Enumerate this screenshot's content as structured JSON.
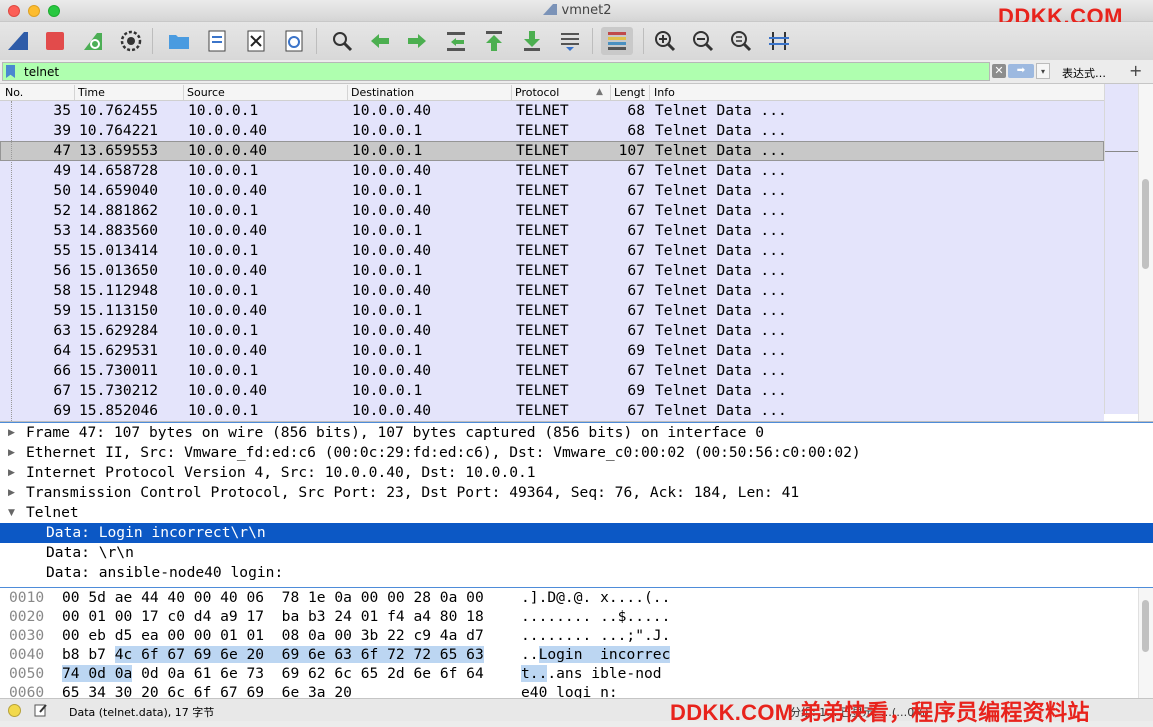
{
  "window": {
    "title": "vmnet2",
    "watermark_top": "DDKK.COM",
    "watermark_bottom": "DDKK.COM 弟弟快看，程序员编程资料站"
  },
  "toolbar": {
    "buttons": [
      "start-capture-icon",
      "stop-capture-icon",
      "restart-capture-icon",
      "capture-options-icon",
      "open-file-icon",
      "save-file-icon",
      "close-file-icon",
      "reload-file-icon",
      "find-packet-icon",
      "go-back-icon",
      "go-forward-icon",
      "go-to-packet-icon",
      "go-first-icon",
      "go-last-icon",
      "autoscroll-icon",
      "colorize-icon",
      "zoom-in-icon",
      "zoom-out-icon",
      "zoom-normal-icon",
      "resize-columns-icon"
    ]
  },
  "filter": {
    "value": "telnet",
    "expression_label": "表达式…",
    "plus_label": "+"
  },
  "columns": [
    "No.",
    "Time",
    "Source",
    "Destination",
    "Protocol",
    "Lengt",
    "Info"
  ],
  "packets": [
    {
      "no": "35",
      "time": "10.762455",
      "src": "10.0.0.1",
      "dst": "10.0.0.40",
      "proto": "TELNET",
      "len": "68",
      "info": "Telnet Data ..."
    },
    {
      "no": "39",
      "time": "10.764221",
      "src": "10.0.0.40",
      "dst": "10.0.0.1",
      "proto": "TELNET",
      "len": "68",
      "info": "Telnet Data ..."
    },
    {
      "no": "47",
      "time": "13.659553",
      "src": "10.0.0.40",
      "dst": "10.0.0.1",
      "proto": "TELNET",
      "len": "107",
      "info": "Telnet Data ...",
      "selected": true
    },
    {
      "no": "49",
      "time": "14.658728",
      "src": "10.0.0.1",
      "dst": "10.0.0.40",
      "proto": "TELNET",
      "len": "67",
      "info": "Telnet Data ..."
    },
    {
      "no": "50",
      "time": "14.659040",
      "src": "10.0.0.40",
      "dst": "10.0.0.1",
      "proto": "TELNET",
      "len": "67",
      "info": "Telnet Data ..."
    },
    {
      "no": "52",
      "time": "14.881862",
      "src": "10.0.0.1",
      "dst": "10.0.0.40",
      "proto": "TELNET",
      "len": "67",
      "info": "Telnet Data ..."
    },
    {
      "no": "53",
      "time": "14.883560",
      "src": "10.0.0.40",
      "dst": "10.0.0.1",
      "proto": "TELNET",
      "len": "67",
      "info": "Telnet Data ..."
    },
    {
      "no": "55",
      "time": "15.013414",
      "src": "10.0.0.1",
      "dst": "10.0.0.40",
      "proto": "TELNET",
      "len": "67",
      "info": "Telnet Data ..."
    },
    {
      "no": "56",
      "time": "15.013650",
      "src": "10.0.0.40",
      "dst": "10.0.0.1",
      "proto": "TELNET",
      "len": "67",
      "info": "Telnet Data ..."
    },
    {
      "no": "58",
      "time": "15.112948",
      "src": "10.0.0.1",
      "dst": "10.0.0.40",
      "proto": "TELNET",
      "len": "67",
      "info": "Telnet Data ..."
    },
    {
      "no": "59",
      "time": "15.113150",
      "src": "10.0.0.40",
      "dst": "10.0.0.1",
      "proto": "TELNET",
      "len": "67",
      "info": "Telnet Data ..."
    },
    {
      "no": "63",
      "time": "15.629284",
      "src": "10.0.0.1",
      "dst": "10.0.0.40",
      "proto": "TELNET",
      "len": "67",
      "info": "Telnet Data ..."
    },
    {
      "no": "64",
      "time": "15.629531",
      "src": "10.0.0.40",
      "dst": "10.0.0.1",
      "proto": "TELNET",
      "len": "69",
      "info": "Telnet Data ..."
    },
    {
      "no": "66",
      "time": "15.730011",
      "src": "10.0.0.1",
      "dst": "10.0.0.40",
      "proto": "TELNET",
      "len": "67",
      "info": "Telnet Data ..."
    },
    {
      "no": "67",
      "time": "15.730212",
      "src": "10.0.0.40",
      "dst": "10.0.0.1",
      "proto": "TELNET",
      "len": "69",
      "info": "Telnet Data ..."
    },
    {
      "no": "69",
      "time": "15.852046",
      "src": "10.0.0.1",
      "dst": "10.0.0.40",
      "proto": "TELNET",
      "len": "67",
      "info": "Telnet Data ..."
    }
  ],
  "details": [
    {
      "text": "Frame 47: 107 bytes on wire (856 bits), 107 bytes captured (856 bits) on interface 0",
      "arrow": "▶"
    },
    {
      "text": "Ethernet II, Src: Vmware_fd:ed:c6 (00:0c:29:fd:ed:c6), Dst: Vmware_c0:00:02 (00:50:56:c0:00:02)",
      "arrow": "▶"
    },
    {
      "text": "Internet Protocol Version 4, Src: 10.0.0.40, Dst: 10.0.0.1",
      "arrow": "▶"
    },
    {
      "text": "Transmission Control Protocol, Src Port: 23, Dst Port: 49364, Seq: 76, Ack: 184, Len: 41",
      "arrow": "▶"
    },
    {
      "text": "Telnet",
      "arrow": "▼"
    },
    {
      "text": "Data: Login incorrect\\r\\n",
      "sub": true,
      "highlighted": true
    },
    {
      "text": "Data: \\r\\n",
      "sub": true
    },
    {
      "text": "Data: ansible-node40 login:",
      "sub": true
    }
  ],
  "bytes": [
    {
      "offset": "0010",
      "pre": "00 5d ae 44 40 00 40 06  78 1e 0a 00 00 28 0a 00",
      "hl": "",
      "post": "",
      "asc_pre": ".].D@.@. x....(..",
      "asc_hl": "",
      "asc_post": ""
    },
    {
      "offset": "0020",
      "pre": "00 01 00 17 c0 d4 a9 17  ba b3 24 01 f4 a4 80 18",
      "hl": "",
      "post": "",
      "asc_pre": "........ ..$.....",
      "asc_hl": "",
      "asc_post": ""
    },
    {
      "offset": "0030",
      "pre": "00 eb d5 ea 00 00 01 01  08 0a 00 3b 22 c9 4a d7",
      "hl": "",
      "post": "",
      "asc_pre": "........ ...;\".J.",
      "asc_hl": "",
      "asc_post": ""
    },
    {
      "offset": "0040",
      "pre": "b8 b7 ",
      "hl": "4c 6f 67 69 6e 20  69 6e 63 6f 72 72 65 63",
      "post": "",
      "asc_pre": "..",
      "asc_hl": "Login  incorrec",
      "asc_post": ""
    },
    {
      "offset": "0050",
      "pre": "",
      "hl": "74 0d 0a",
      "post": " 0d 0a 61 6e 73  69 62 6c 65 2d 6e 6f 64",
      "asc_pre": "",
      "asc_hl": "t..",
      "asc_post": ".ans ible-nod"
    },
    {
      "offset": "0060",
      "pre": "65 34 30 20 6c 6f 67 69  6e 3a 20",
      "hl": "",
      "post": "",
      "asc_pre": "e40 logi n: ",
      "asc_hl": "",
      "asc_post": ""
    }
  ],
  "status": {
    "text": "Data (telnet.data), 17 字节",
    "packets": "分组: 1… 已显示: …(…0%)"
  }
}
